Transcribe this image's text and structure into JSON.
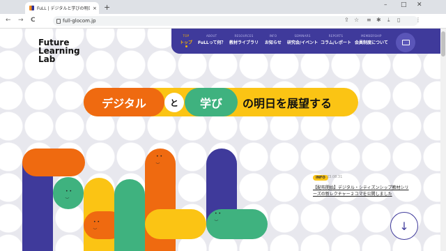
{
  "browser": {
    "tab_title": "FuLL | デジタルと学びの明日を展望",
    "tab_close": "×",
    "new_tab": "+",
    "url": "full-glocom.jp",
    "win_min": "–",
    "win_max": "□",
    "win_close": "✕",
    "back": "←",
    "forward": "→",
    "reload": "C"
  },
  "logo": {
    "line1": "Future",
    "line2": "Learning",
    "line3": "Lab"
  },
  "nav": {
    "items": [
      {
        "en": "TOP",
        "jp": "トップ"
      },
      {
        "en": "ABOUT",
        "jp": "FuLLって何？"
      },
      {
        "en": "RESOURCES",
        "jp": "教材ライブラリ"
      },
      {
        "en": "INFO",
        "jp": "お知らせ"
      },
      {
        "en": "SEMINARS",
        "jp": "研究会/イベント"
      },
      {
        "en": "REPORTS",
        "jp": "コラム/レポート"
      },
      {
        "en": "MEMBERSHIP",
        "jp": "会員制度について"
      }
    ]
  },
  "headline": {
    "part1": "デジタル",
    "part2": "と",
    "part3": "学び",
    "part4": "の明日を展望する"
  },
  "news": {
    "badge": "INFO",
    "date": "23.08.31",
    "text": "【配布開始】デジタル・シティズンシップ教材シリーズの新レクチャー２コマを公開しました"
  },
  "colors": {
    "navy": "#3f3a9b",
    "orange": "#ef6a10",
    "yellow": "#fbc414",
    "green": "#3fb27f"
  }
}
